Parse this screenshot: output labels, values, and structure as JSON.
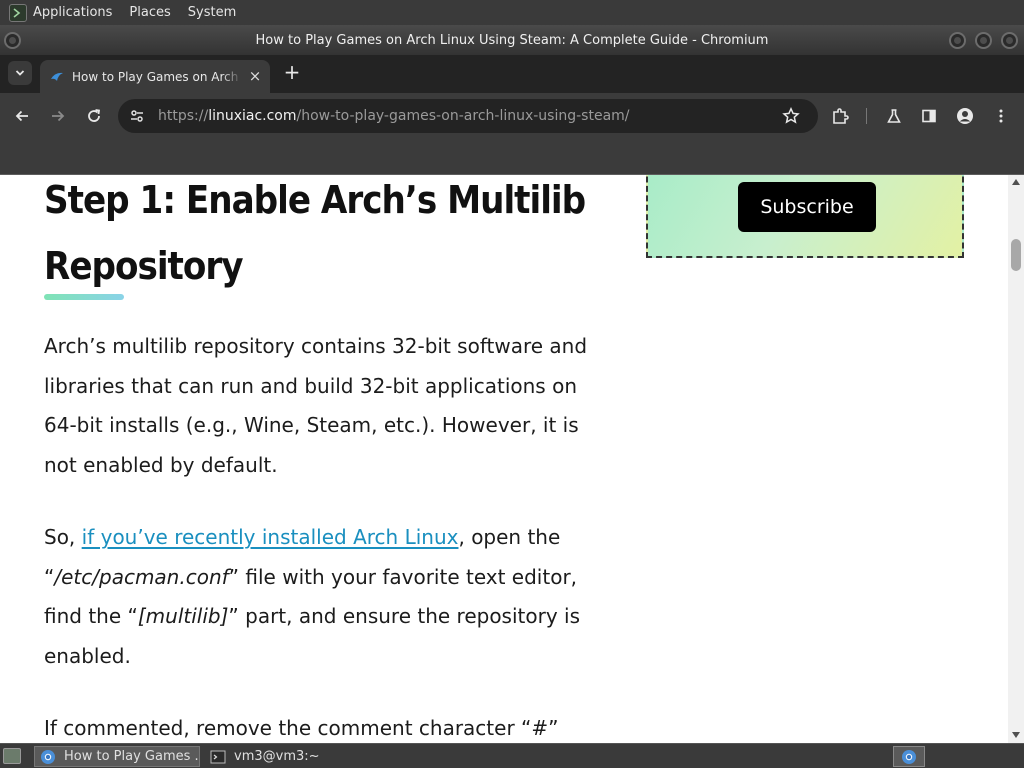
{
  "system_panel": {
    "menus": [
      "Applications",
      "Places",
      "System"
    ]
  },
  "window": {
    "title": "How to Play Games on Arch Linux Using Steam: A Complete Guide - Chromium"
  },
  "tabs": [
    {
      "label": "How to Play Games on Arch Linux Using Steam: A Complete Guide",
      "active": true
    }
  ],
  "toolbar": {
    "url_scheme": "https://",
    "url_host": "linuxiac.com",
    "url_path": "/how-to-play-games-on-arch-linux-using-steam/"
  },
  "article": {
    "heading_line1": "Step 1: Enable Arch’s Multilib",
    "heading_line2": "Repository",
    "para1": "Arch’s multilib repository contains 32-bit software and libraries that can run and build 32-bit applications on 64-bit installs (e.g., Wine, Steam, etc.). However, it is not enabled by default.",
    "para2_before": "So, ",
    "para2_link": "if you’ve recently installed Arch Linux",
    "para2_mid1": ", open the “",
    "para2_em1": "/etc/pacman.conf",
    "para2_mid2": "” file with your favorite text editor, find the “",
    "para2_em2": "[multilib]",
    "para2_after": "” part, and ensure the repository is enabled.",
    "para3": "If commented, remove the comment character “#”"
  },
  "sidebar": {
    "subscribe_label": "Subscribe"
  },
  "taskbar": {
    "tasks": [
      {
        "label": "How to Play Games ...",
        "active": true
      },
      {
        "label": "vm3@vm3:~",
        "active": false
      }
    ]
  },
  "colors": {
    "link": "#1a8fbf",
    "heading_underline": "#7fe3b5",
    "subscribe_bg": "#000000"
  }
}
